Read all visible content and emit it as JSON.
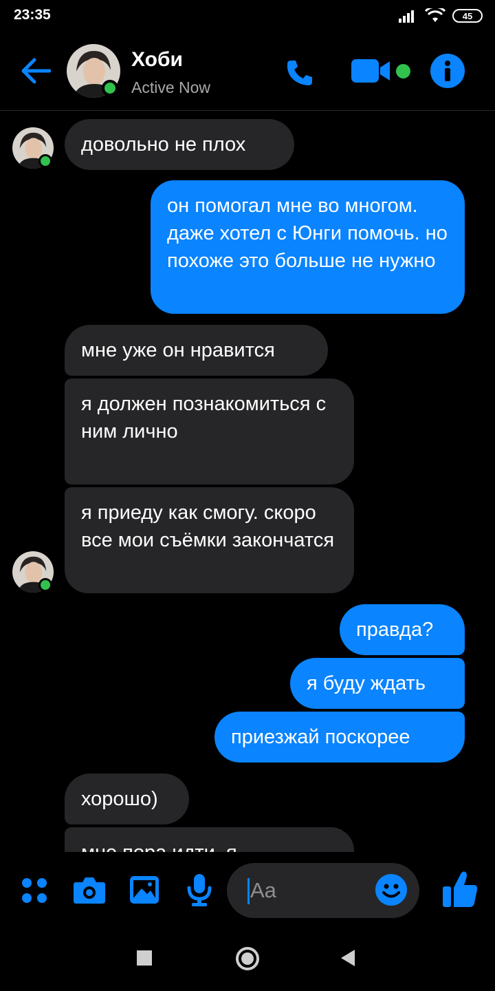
{
  "status_bar": {
    "time": "23:35",
    "battery": "45"
  },
  "header": {
    "contact_name": "Хоби",
    "status": "Active Now"
  },
  "messages": [
    {
      "side": "in",
      "text": "довольно не плох"
    },
    {
      "side": "out",
      "text": "он помогал мне во многом. даже хотел с Юнги помочь. но похоже это больше не нужно"
    },
    {
      "side": "in",
      "text": "мне уже он нравится"
    },
    {
      "side": "in",
      "text": "я должен познакомиться с ним лично"
    },
    {
      "side": "in",
      "text": "я приеду как смогу. скоро все мои съёмки закончатся"
    },
    {
      "side": "out",
      "text": "правда?"
    },
    {
      "side": "out",
      "text": "я буду ждать"
    },
    {
      "side": "out",
      "text": "приезжай поскорее"
    },
    {
      "side": "in",
      "text": "хорошо)"
    },
    {
      "side": "in",
      "text": "мне пора идти. я"
    }
  ],
  "composer": {
    "placeholder": "Aa"
  },
  "colors": {
    "accent": "#0a84ff",
    "incoming_bubble": "#262628",
    "online": "#31c24d",
    "background": "#000000"
  },
  "icons": [
    "back-arrow-icon",
    "phone-icon",
    "video-camera-icon",
    "info-icon",
    "menu-dots-icon",
    "camera-icon",
    "gallery-icon",
    "microphone-icon",
    "emoji-icon",
    "thumbs-up-icon",
    "nav-square-icon",
    "nav-circle-icon",
    "nav-back-icon"
  ]
}
